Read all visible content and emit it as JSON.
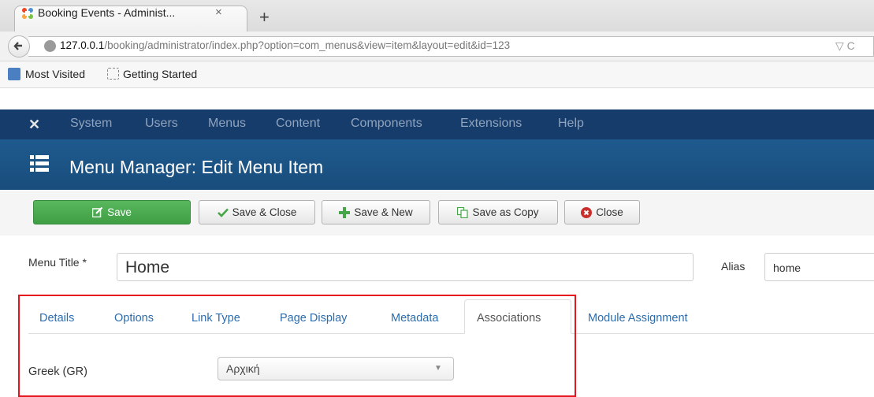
{
  "browser": {
    "tab_title": "Booking Events - Administ...",
    "tab_close": "×",
    "new_tab": "+",
    "url_host": "127.0.0.1",
    "url_path": "/booking/administrator/index.php?option=com_menus&view=item&layout=edit&id=123",
    "url_right": "▽ C",
    "bookmarks": [
      "Most Visited",
      "Getting Started"
    ]
  },
  "admin_menu": {
    "logo": "✕",
    "items": [
      "System",
      "Users",
      "Menus",
      "Content",
      "Components",
      "Extensions",
      "Help"
    ]
  },
  "header": {
    "title": "Menu Manager: Edit Menu Item"
  },
  "toolbar": {
    "save": "Save",
    "save_close": "Save & Close",
    "save_new": "Save & New",
    "save_copy": "Save as Copy",
    "close": "Close"
  },
  "form": {
    "menu_title_label": "Menu Title *",
    "menu_title_value": "Home",
    "alias_label": "Alias",
    "alias_value": "home"
  },
  "tabs": [
    "Details",
    "Options",
    "Link Type",
    "Page Display",
    "Metadata",
    "Associations",
    "Module Assignment"
  ],
  "active_tab": "Associations",
  "associations": {
    "label": "Greek (GR)",
    "selected": "Αρχική",
    "arrow": "▼"
  },
  "colors": {
    "admin_nav": "#163c6b",
    "header": "#1f5a8e",
    "save_button": "#46a546",
    "link": "#2d6cad",
    "highlight_box": "#e4151d"
  }
}
